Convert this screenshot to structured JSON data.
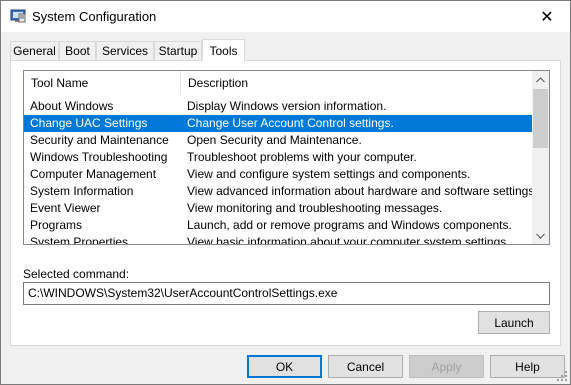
{
  "window": {
    "title": "System Configuration",
    "icon": "msconfig-icon",
    "close_glyph": "✕"
  },
  "tabs": [
    {
      "label": "General",
      "active": false
    },
    {
      "label": "Boot",
      "active": false
    },
    {
      "label": "Services",
      "active": false
    },
    {
      "label": "Startup",
      "active": false
    },
    {
      "label": "Tools",
      "active": true
    }
  ],
  "tools_list": {
    "columns": [
      "Tool Name",
      "Description"
    ],
    "rows": [
      {
        "name": "About Windows",
        "description": "Display Windows version information."
      },
      {
        "name": "Change UAC Settings",
        "description": "Change User Account Control settings.",
        "selected": true
      },
      {
        "name": "Security and Maintenance",
        "description": "Open Security and Maintenance."
      },
      {
        "name": "Windows Troubleshooting",
        "description": "Troubleshoot problems with your computer."
      },
      {
        "name": "Computer Management",
        "description": "View and configure system settings and components."
      },
      {
        "name": "System Information",
        "description": "View advanced information about hardware and software settings."
      },
      {
        "name": "Event Viewer",
        "description": "View monitoring and troubleshooting messages."
      },
      {
        "name": "Programs",
        "description": "Launch, add or remove programs and Windows components."
      },
      {
        "name": "System Properties",
        "description": "View basic information about your computer system settings."
      }
    ],
    "selected_color": "#0078d7"
  },
  "selected_command": {
    "label": "Selected command:",
    "value": "C:\\WINDOWS\\System32\\UserAccountControlSettings.exe"
  },
  "buttons": {
    "launch": "Launch",
    "ok": "OK",
    "cancel": "Cancel",
    "apply": "Apply",
    "help": "Help"
  }
}
